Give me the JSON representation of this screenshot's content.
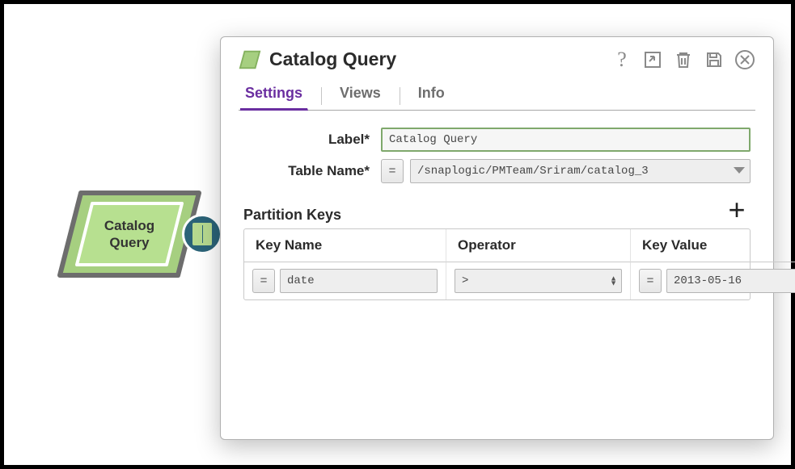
{
  "pipeline": {
    "snap_label": "Catalog\nQuery"
  },
  "dialog": {
    "title": "Catalog Query",
    "tabs": [
      "Settings",
      "Views",
      "Info"
    ],
    "active_tab": 0,
    "fields": {
      "label_caption": "Label*",
      "label_value": "Catalog Query",
      "table_name_caption": "Table Name*",
      "table_name_value": "/snaplogic/PMTeam/Sriram/catalog_3"
    },
    "partition_keys": {
      "section_title": "Partition Keys",
      "columns": [
        "Key Name",
        "Operator",
        "Key Value"
      ],
      "rows": [
        {
          "key_name": "date",
          "operator": ">",
          "key_value": "2013-05-16"
        }
      ]
    },
    "toolbar": {
      "help": "?",
      "export": "export-icon",
      "delete": "trash-icon",
      "save": "save-icon",
      "close": "close-icon"
    }
  }
}
